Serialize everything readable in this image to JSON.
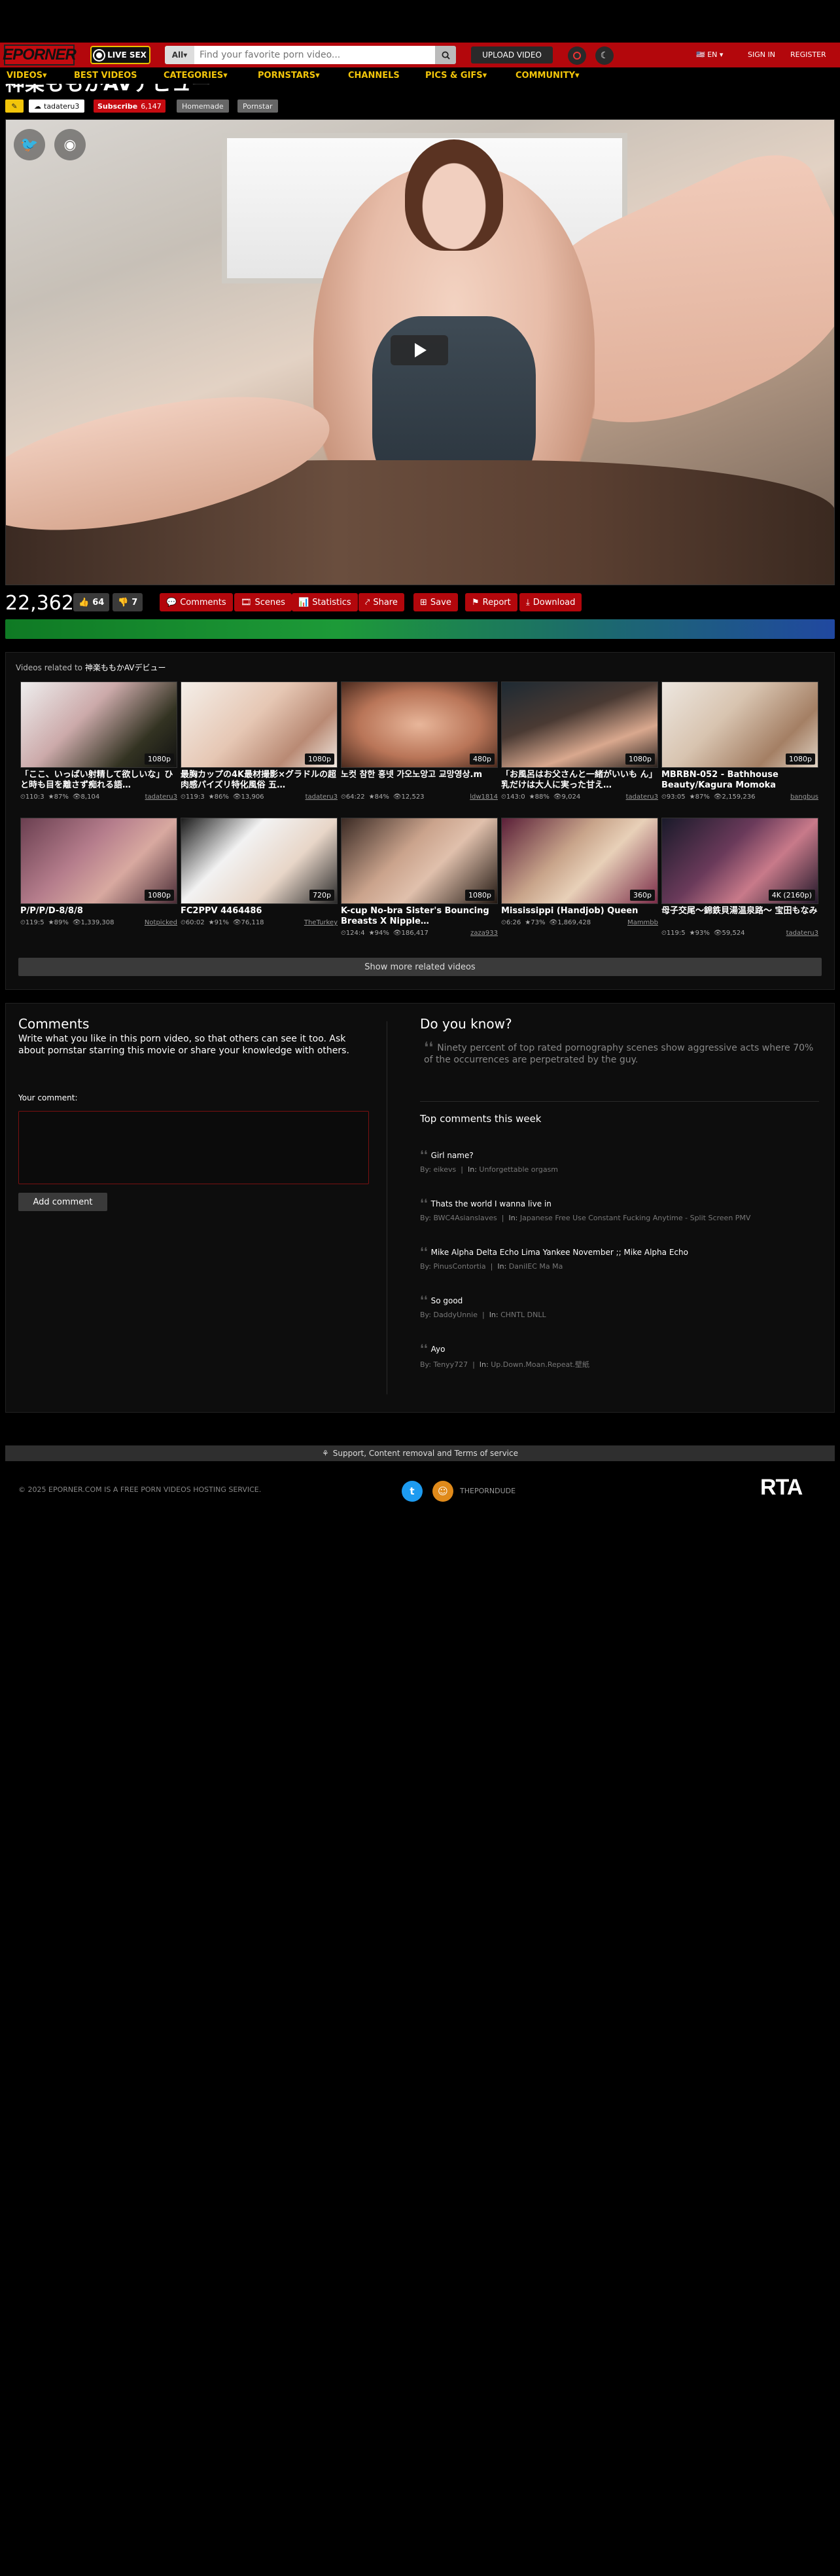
{
  "header": {
    "logo": "EPORNER",
    "live_sex": "LIVE SEX",
    "search_category": "All",
    "search_placeholder": "Find your favorite porn video...",
    "upload": "UPLOAD VIDEO",
    "language": "EN",
    "sign_in": "SIGN IN",
    "register": "REGISTER",
    "accent": "#b3070c"
  },
  "nav": [
    {
      "label": "VIDEOS▾"
    },
    {
      "label": "BEST VIDEOS"
    },
    {
      "label": "CATEGORIES▾"
    },
    {
      "label": "PORNSTARS▾"
    },
    {
      "label": "CHANNELS"
    },
    {
      "label": "PICS & GIFS▾"
    },
    {
      "label": "COMMUNITY▾"
    }
  ],
  "video": {
    "title_partial": "神楽ももかAVデビュー",
    "uploader": "tadateru3",
    "subscribe": "Subscribe",
    "subscribers": "6,147",
    "tags": [
      "Homemade",
      "Pornstar"
    ],
    "views": "22,362",
    "likes": "64",
    "dislikes": "7",
    "actions": [
      "Comments",
      "Scenes",
      "Statistics",
      "Share",
      "Save",
      "Report",
      "Download"
    ]
  },
  "related": {
    "prefix": "Videos related to",
    "title": "神楽ももかAVデビュー",
    "show_more": "Show more related videos",
    "items": [
      {
        "title": "「ここ、いっぱい射精して欲しいな」ひと時も目を離さず痴れる語…",
        "res": "1080p",
        "time": "110:3",
        "rating": "87%",
        "views": "8,104",
        "uploader": "tadateru3"
      },
      {
        "title": "最胸カップの4K最材撮影×グラドルの超肉感パイズリ特化風俗 五…",
        "res": "1080p",
        "time": "119:3",
        "rating": "86%",
        "views": "13,906",
        "uploader": "tadateru3"
      },
      {
        "title": "노컷 참한 흥넷 가오노앙고 교망영상.m",
        "res": "480p",
        "time": "64:22",
        "rating": "84%",
        "views": "12,523",
        "uploader": "ldw1814"
      },
      {
        "title": "「お風呂はお父さんと一緒がいいも ん」乳だけは大人に実った甘え…",
        "res": "1080p",
        "time": "143:0",
        "rating": "88%",
        "views": "9,024",
        "uploader": "tadateru3"
      },
      {
        "title": "MBRBN-052 - Bathhouse Beauty/Kagura Momoka",
        "res": "1080p",
        "time": "93:05",
        "rating": "87%",
        "views": "2,159,236",
        "uploader": "bangbus"
      },
      {
        "title": "P/P/P/D-8/8/8",
        "res": "1080p",
        "time": "119:5",
        "rating": "89%",
        "views": "1,339,308",
        "uploader": "Notpicked"
      },
      {
        "title": "FC2PPV 4464486",
        "res": "720p",
        "time": "60:02",
        "rating": "91%",
        "views": "76,118",
        "uploader": "TheTurkey"
      },
      {
        "title": "K-cup No-bra Sister's Bouncing Breasts X Nipple…",
        "res": "1080p",
        "time": "124:4",
        "rating": "94%",
        "views": "186,417",
        "uploader": "zaza933"
      },
      {
        "title": "Mississippi (Handjob) Queen",
        "res": "360p",
        "time": "6:26",
        "rating": "73%",
        "views": "1,869,428",
        "uploader": "Mammbb"
      },
      {
        "title": "母子交尾～錦鉄貝湯温泉路～ 宝田もなみ",
        "res": "4K (2160p)",
        "time": "119:5",
        "rating": "93%",
        "views": "59,524",
        "uploader": "tadateru3"
      }
    ]
  },
  "comments": {
    "title": "Comments",
    "desc": "Write what you like in this porn video, so that others can see it too. Ask about pornstar starring this movie or share your knowledge with others.",
    "label": "Your comment:",
    "add": "Add comment"
  },
  "dyk": {
    "title": "Do you know?",
    "text": "Ninety percent of top rated pornography scenes show aggressive acts where 70% of the occurrences are perpetrated by the guy."
  },
  "top_comments": {
    "title": "Top comments this week",
    "by_label": "By:",
    "in_label": "In:",
    "items": [
      {
        "text": "Girl name?",
        "by": "eikevs",
        "in": "Unforgettable orgasm"
      },
      {
        "text": "Thats the world I wanna live in",
        "by": "BWC4Asianslaves",
        "in": "Japanese Free Use Constant Fucking Anytime - Split Screen PMV"
      },
      {
        "text": "Mike Alpha Delta Echo Lima Yankee November ;; Mike Alpha Echo",
        "by": "PinusContortia",
        "in": "DaniIEC Ma Ma"
      },
      {
        "text": "So good",
        "by": "DaddyUnnie",
        "in": "CHNTL DNLL"
      },
      {
        "text": "Ayo",
        "by": "Tenyy727",
        "in": "Up.Down.Moan.Repeat.壁紙"
      }
    ]
  },
  "footer": {
    "support": "Support, Content removal and Terms of service",
    "copyright": "© 2025 EPORNER.COM IS A FREE PORN VIDEOS HOSTING SERVICE.",
    "link": "THEPORNDUDE",
    "rta": "RTA"
  }
}
